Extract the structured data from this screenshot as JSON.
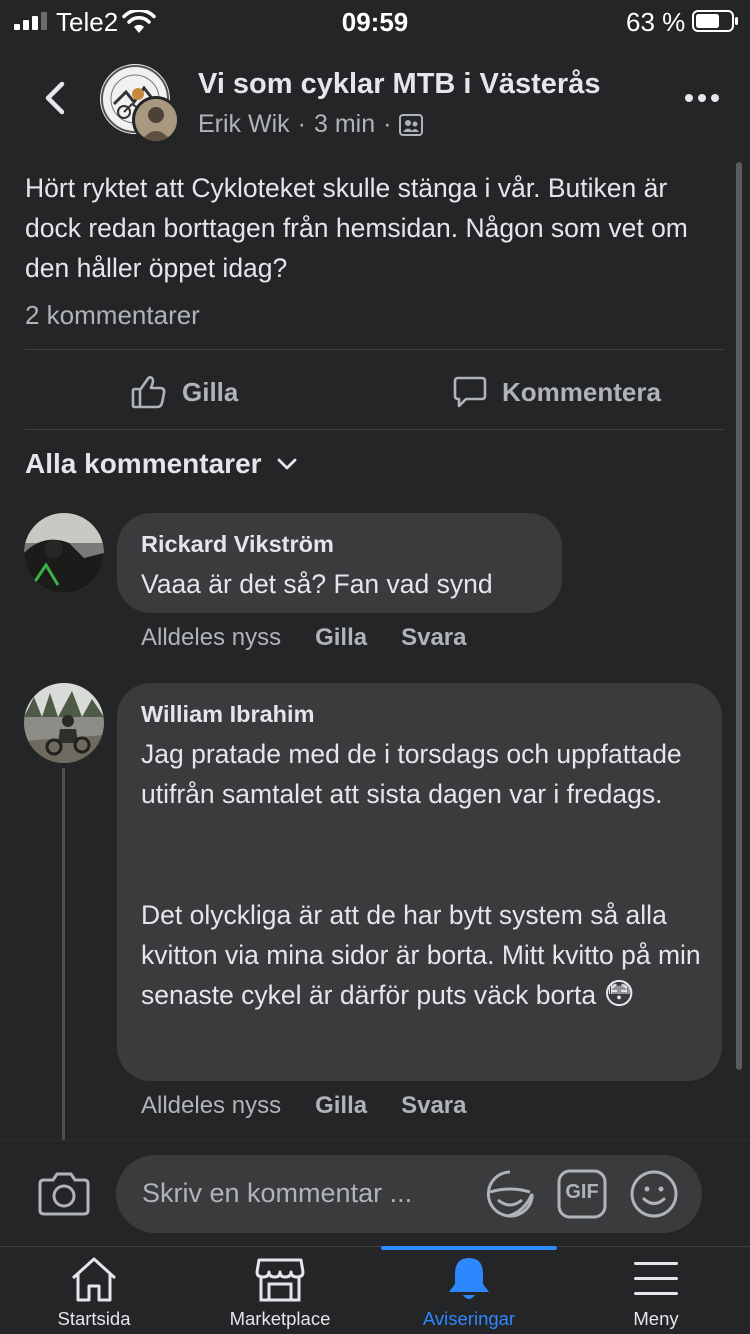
{
  "status_bar": {
    "carrier": "Tele2",
    "time": "09:59",
    "battery": "63 %"
  },
  "header": {
    "group_name": "Vi som cyklar MTB i Västerås",
    "poster": "Erik Wik",
    "separator": "·",
    "time": "3 min",
    "icons": [
      "back-chevron-icon",
      "group-members-icon",
      "more-dots-icon"
    ]
  },
  "post": {
    "text": "Hört ryktet att Cykloteket skulle stänga i vår. Butiken är dock redan borttagen från hemsidan. Någon som vet om den håller öppet idag?",
    "comment_count": "2 kommentarer",
    "actions": {
      "like": "Gilla",
      "comment": "Kommentera"
    }
  },
  "comments_section": {
    "filter_label": "Alla kommentarer",
    "comments": [
      {
        "author": "Rickard Vikström",
        "text": "Vaaa är det så? Fan vad synd",
        "time": "Alldeles nyss",
        "like": "Gilla",
        "reply": "Svara"
      },
      {
        "author": "William Ibrahim",
        "paragraphs": [
          "Jag pratade med de i torsdags och uppfattade utifrån samtalet att sista dagen var i fredags.",
          "Det olyckliga är att de har bytt system så alla kvitton via mina sidor är borta. Mitt kvitto på min senaste cykel är därför puts väck borta"
        ],
        "emoji": "😳",
        "time": "Alldeles nyss",
        "like": "Gilla",
        "reply": "Svara"
      }
    ]
  },
  "composer": {
    "placeholder": "Skriv en kommentar ...",
    "gif_label": "GIF"
  },
  "tab_bar": {
    "active_color": "#2d88ff",
    "tabs": [
      {
        "label": "Startsida",
        "icon": "home-icon"
      },
      {
        "label": "Marketplace",
        "icon": "marketplace-icon"
      },
      {
        "label": "Aviseringar",
        "icon": "bell-icon",
        "active": true
      },
      {
        "label": "Meny",
        "icon": "menu-icon"
      }
    ]
  }
}
